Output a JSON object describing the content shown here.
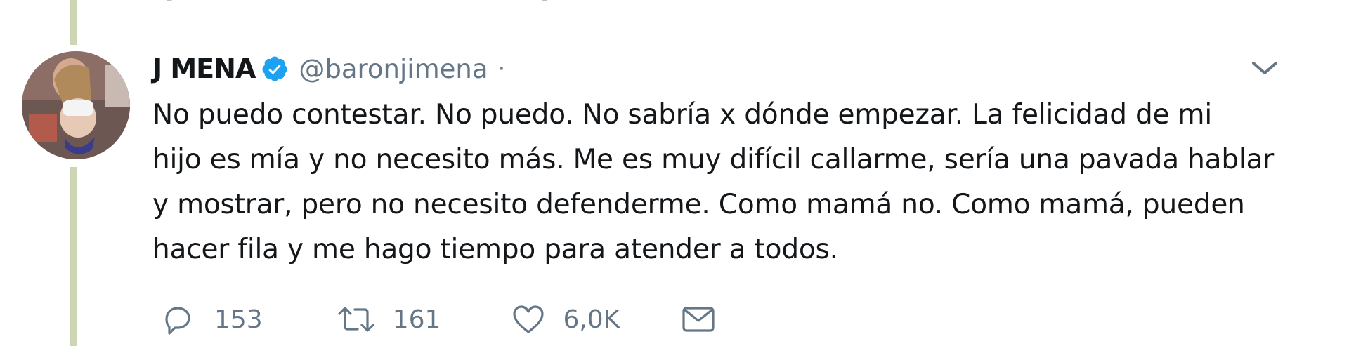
{
  "colors": {
    "verified": "#1da1f2",
    "thread_line": "#cdd6b4",
    "muted": "#657786",
    "text": "#14171a"
  },
  "tweet": {
    "display_name": "J MENA",
    "handle": "@baronjimena",
    "separator": "·",
    "body_lines": [
      "No puedo contestar. No puedo. No sabría x dónde empezar. La felicidad de mi",
      "hijo es mía y no necesito más. Me es muy difícil callarme, sería una pavada hablar",
      "y mostrar, pero no necesito defenderme. Como mamá no. Como mamá, pueden",
      "hacer fila y me hago tiempo para atender a todos."
    ],
    "actions": {
      "replies": "153",
      "retweets": "161",
      "likes": "6,0K"
    },
    "icons": [
      "avatar",
      "verified-badge-icon",
      "chevron-down-icon",
      "reply-icon",
      "retweet-icon",
      "like-icon",
      "direct-message-icon"
    ]
  }
}
